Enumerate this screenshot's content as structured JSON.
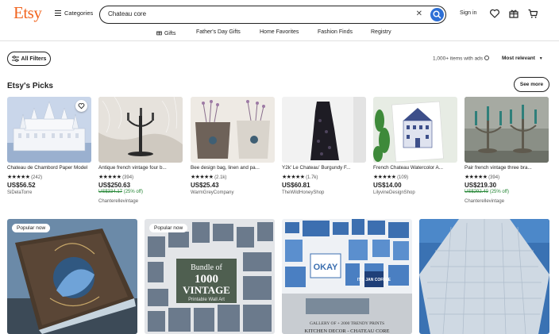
{
  "header": {
    "logo": "Etsy",
    "categories_label": "Categories",
    "search_value": "Chateau core",
    "signin_label": "Sign in"
  },
  "subnav": {
    "items": [
      "Gifts",
      "Father's Day Gifts",
      "Home Favorites",
      "Fashion Finds",
      "Registry"
    ]
  },
  "filters": {
    "all_filters_label": "All Filters",
    "results_text": "1,000+ items with ads",
    "sort_label": "Most relevant"
  },
  "picks": {
    "title": "Etsy's Picks",
    "see_more_label": "See more",
    "items": [
      {
        "title": "Chateau de Chambord Paper Model",
        "stars": "★★★★★",
        "reviews": "(242)",
        "price": "US$56.52",
        "original_price": "",
        "discount": "",
        "shop": "SiDelaTorre"
      },
      {
        "title": "Antique french vintage four b...",
        "stars": "★★★★★",
        "reviews": "(394)",
        "price": "US$250.63",
        "original_price": "US$334.17",
        "discount": "(25% off)",
        "shop": "Chanterellevintage"
      },
      {
        "title": "Bee design bag, linen and pa...",
        "stars": "★★★★★",
        "reviews": "(2.1k)",
        "price": "US$25.43",
        "original_price": "",
        "discount": "",
        "shop": "WarmGreyCompany"
      },
      {
        "title": "Y2k' Le Chateau' Burgundy F...",
        "stars": "★★★★★",
        "reviews": "(1.7k)",
        "price": "US$60.81",
        "original_price": "",
        "discount": "",
        "shop": "TheWildHoneyShop"
      },
      {
        "title": "French Chateau Watercolor A...",
        "stars": "★★★★★",
        "reviews": "(109)",
        "price": "US$14.00",
        "original_price": "",
        "discount": "",
        "shop": "LilyvineDesignShop"
      },
      {
        "title": "Pair french vintage three bra...",
        "stars": "★★★★★",
        "reviews": "(394)",
        "price": "US$219.30",
        "original_price": "US$292.40",
        "discount": "(25% off)",
        "shop": "Chanterellevintage"
      }
    ]
  },
  "grid": {
    "badge_label": "Popular now",
    "bundle_text": {
      "line1": "Bundle of",
      "line2": "1000",
      "line3": "VINTAGE",
      "line4": "Printable Wall Art"
    },
    "gallery_text": {
      "okay": "OKAY",
      "itsjan": "IT'S JAN COFFEE",
      "caption1": "GALLERY OF + 2000 TRENDY PRINTS",
      "caption2": "KITCHEN DECOR - CHATEAU CORE"
    }
  },
  "colors": {
    "brand": "#f1641e",
    "search_button": "#2d6fd6",
    "discount": "#258635"
  }
}
